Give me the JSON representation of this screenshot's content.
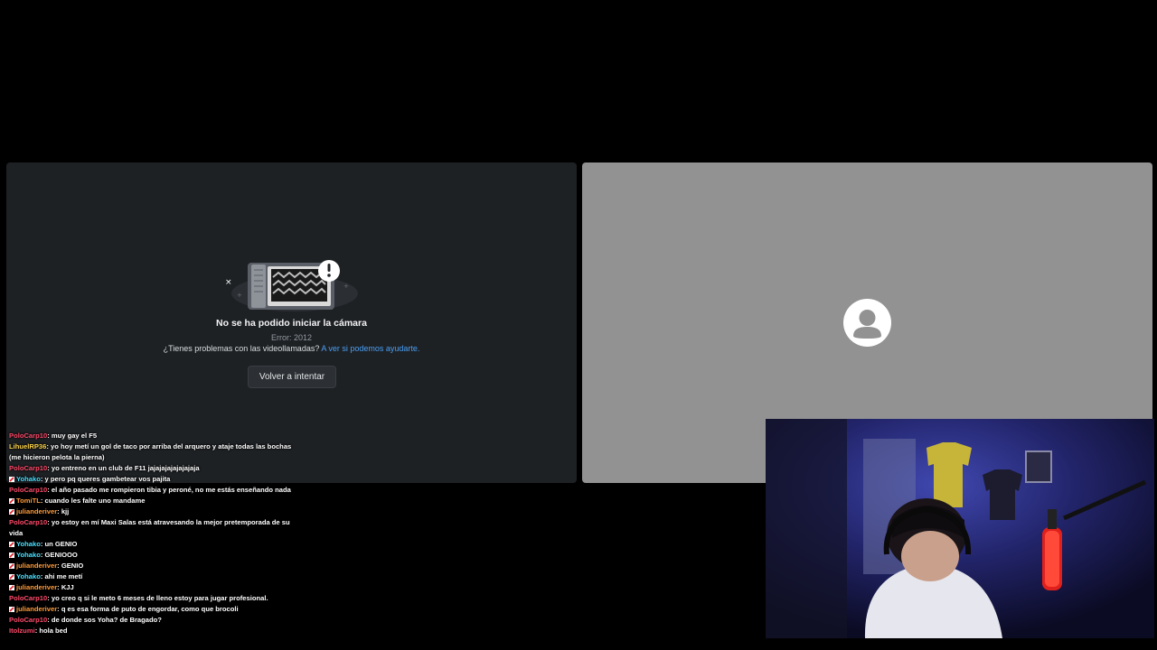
{
  "camera_error": {
    "title": "No se ha podido iniciar la cámara",
    "code": "Error: 2012",
    "help_text": "¿Tienes problemas con las videollamadas?",
    "help_link": "A ver si podemos ayudarte.",
    "retry_label": "Volver a intentar"
  },
  "colors": {
    "left_panel_bg": "#1e2124",
    "right_panel_bg": "#929292",
    "link": "#4a9ff5"
  },
  "chat": [
    {
      "user": "PoloCarp10",
      "color": "#ff4a6a",
      "badge": false,
      "message": "muy gay el F5"
    },
    {
      "user": "LihuelRP36",
      "color": "#ffd54a",
      "badge": false,
      "message": "yo hoy metí un gol de taco por arriba del arquero y ataje todas las bochas (me hicieron pelota la pierna)"
    },
    {
      "user": "PoloCarp10",
      "color": "#ff4a6a",
      "badge": false,
      "message": "yo entreno en un club de F11 jajajajajajajajaja"
    },
    {
      "user": "Yohako",
      "color": "#4ae0ff",
      "badge": true,
      "message": "y pero pq queres gambetear vos pajita"
    },
    {
      "user": "PoloCarp10",
      "color": "#ff4a6a",
      "badge": false,
      "message": "el año pasado me rompieron tibia y peroné, no me estás enseñando nada"
    },
    {
      "user": "TomiTL",
      "color": "#ff9a3a",
      "badge": true,
      "message": "cuando les falte uno mandame"
    },
    {
      "user": "julianderiver",
      "color": "#ff9a3a",
      "badge": true,
      "message": "kjj"
    },
    {
      "user": "PoloCarp10",
      "color": "#ff4a6a",
      "badge": false,
      "message": "yo estoy en mí Maxi Salas está atravesando la mejor pretemporada de su vida"
    },
    {
      "user": "Yohako",
      "color": "#4ae0ff",
      "badge": true,
      "message": "un GENIO"
    },
    {
      "user": "Yohako",
      "color": "#4ae0ff",
      "badge": true,
      "message": "GENIOOO"
    },
    {
      "user": "julianderiver",
      "color": "#ff9a3a",
      "badge": true,
      "message": "GENIO"
    },
    {
      "user": "Yohako",
      "color": "#4ae0ff",
      "badge": true,
      "message": "ahi me metí"
    },
    {
      "user": "julianderiver",
      "color": "#ff9a3a",
      "badge": true,
      "message": "KJJ"
    },
    {
      "user": "PoloCarp10",
      "color": "#ff4a6a",
      "badge": false,
      "message": "yo creo q si le meto 6 meses de lleno estoy para jugar profesional."
    },
    {
      "user": "julianderiver",
      "color": "#ff9a3a",
      "badge": true,
      "message": "q es esa forma de puto de engordar, como que brocoli"
    },
    {
      "user": "PoloCarp10",
      "color": "#ff4a6a",
      "badge": false,
      "message": "de donde sos Yoha? de Bragado?"
    },
    {
      "user": "Itolzumi",
      "color": "#ff4a6a",
      "badge": false,
      "message": "hola bed"
    }
  ]
}
